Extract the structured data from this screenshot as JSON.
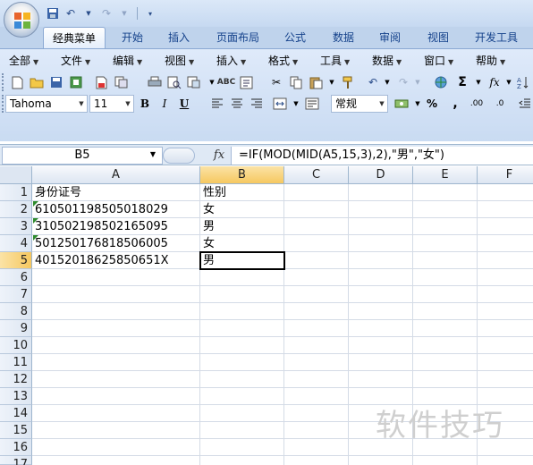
{
  "ribbon": {
    "tabs": [
      "经典菜单",
      "开始",
      "插入",
      "页面布局",
      "公式",
      "数据",
      "审阅",
      "视图",
      "开发工具"
    ],
    "active_tab": "经典菜单",
    "menus": [
      "全部",
      "文件",
      "编辑",
      "视图",
      "插入",
      "格式",
      "工具",
      "数据",
      "窗口",
      "帮助"
    ]
  },
  "toolbar": {
    "font_name": "Tahoma",
    "font_size": "11",
    "number_format": "常规",
    "bold": "B",
    "italic": "I",
    "underline": "U",
    "percent": "%",
    "comma": ",",
    "sigma": "Σ",
    "fx": "fx",
    "inc_decimal": ".00",
    "dec_decimal": ".0"
  },
  "formula_bar": {
    "name_box": "B5",
    "fx_label": "fx",
    "formula": "=IF(MOD(MID(A5,15,3),2),\"男\",\"女\")"
  },
  "sheet": {
    "columns": [
      "A",
      "B",
      "C",
      "D",
      "E",
      "F"
    ],
    "selected_column": "B",
    "selected_row": "5",
    "rows": [
      "1",
      "2",
      "3",
      "4",
      "5",
      "6",
      "7",
      "8",
      "9",
      "10",
      "11",
      "12",
      "13",
      "14",
      "15",
      "16",
      "17"
    ],
    "cells": {
      "A1": "身份证号",
      "B1": "性别",
      "A2": "610501198505018029",
      "B2": "女",
      "A3": "310502198502165095",
      "B3": "男",
      "A4": "501250176818506005",
      "B4": "女",
      "A5": "40152018625850651X",
      "B5": "男"
    }
  },
  "watermark": "软件技巧",
  "colors": {
    "selection": "#f6c860",
    "ribbon": "#c9dbf2",
    "text_indicator": "#2e8b2e"
  }
}
